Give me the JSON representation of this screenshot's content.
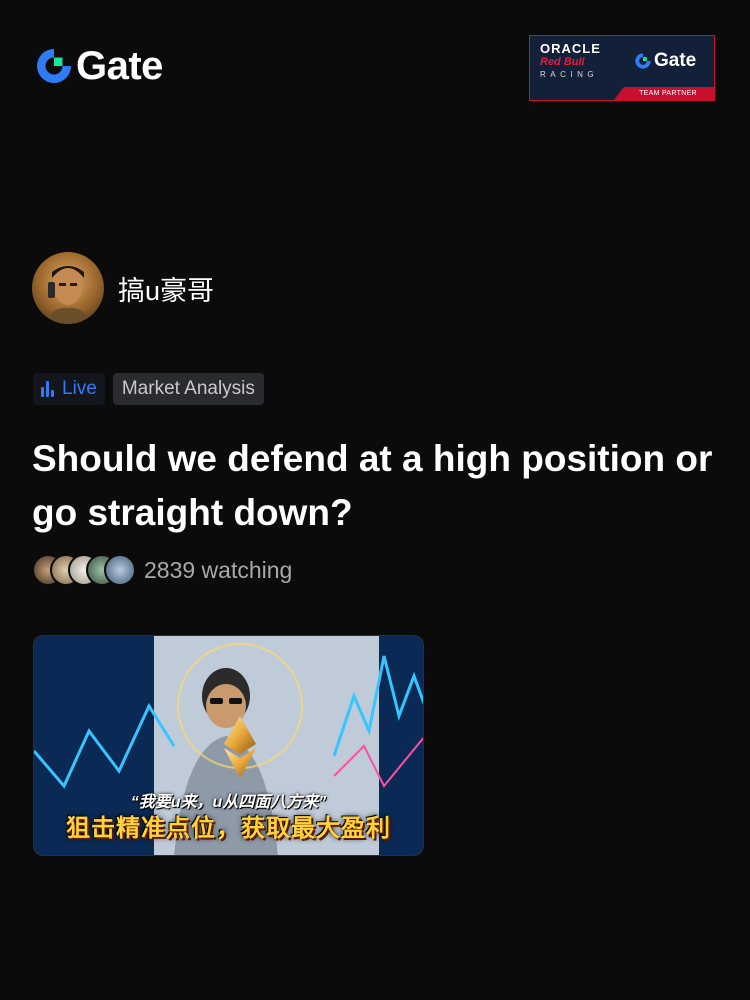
{
  "brand": {
    "logo_text": "Gate",
    "accent": "#2f7cf6",
    "green": "#17e6a1"
  },
  "partner": {
    "oracle": "ORACLE",
    "redbull": "Red Bull",
    "racing": "RACING",
    "gate": "Gate",
    "strip": "TEAM PARTNER"
  },
  "author": {
    "name": "搞u豪哥",
    "avatar_icon": "user-avatar"
  },
  "tags": {
    "live": "Live",
    "category": "Market Analysis"
  },
  "title": "Should we defend at a high position or go straight down?",
  "watching": {
    "count": "2839",
    "label": "2839 watching"
  },
  "thumbnail": {
    "line1": "“我要u来，u从四面八方来”",
    "line2": "狙击精准点位，获取最大盈利",
    "coin_label": "ETH"
  }
}
